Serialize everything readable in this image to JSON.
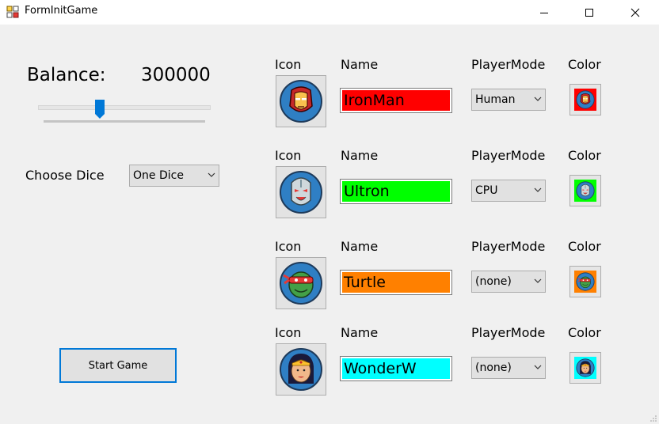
{
  "window": {
    "title": "FormInitGame"
  },
  "balance": {
    "label": "Balance:",
    "value": "300000"
  },
  "slider": {
    "level": 0.36
  },
  "dice": {
    "label": "Choose Dice",
    "selected": "One Dice"
  },
  "start_button": {
    "label": "Start Game"
  },
  "headers": {
    "icon": "Icon",
    "name": "Name",
    "mode": "PlayerMode",
    "color": "Color"
  },
  "players": [
    {
      "name": "IronMan",
      "mode": "Human",
      "color": "#ff0000",
      "icon": "ironman-icon"
    },
    {
      "name": "Ultron",
      "mode": "CPU",
      "color": "#00ff00",
      "icon": "ultron-icon"
    },
    {
      "name": "Turtle",
      "mode": "(none)",
      "color": "#ff8000",
      "icon": "turtle-icon"
    },
    {
      "name": "WonderW",
      "mode": "(none)",
      "color": "#00ffff",
      "icon": "wonderwoman-icon"
    }
  ]
}
